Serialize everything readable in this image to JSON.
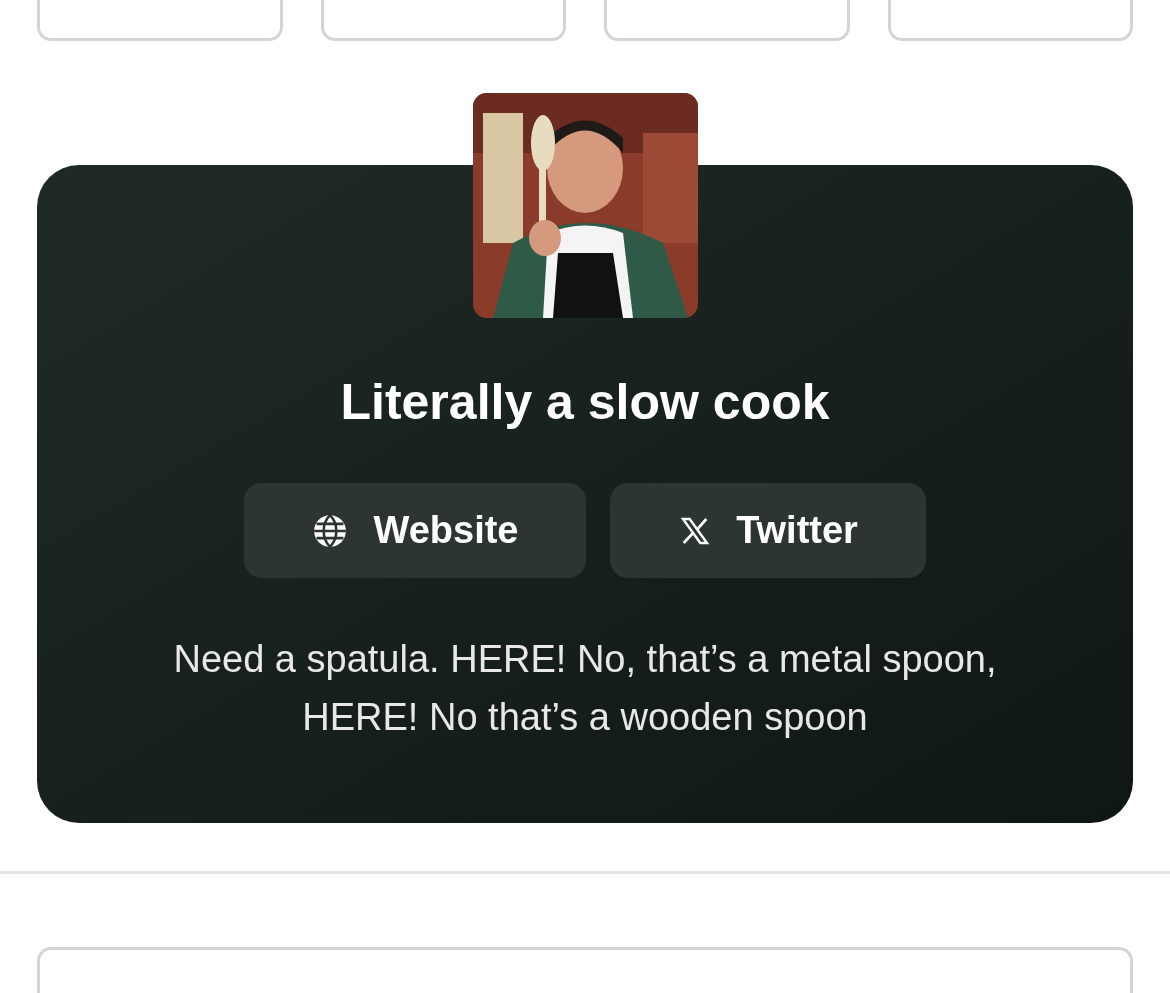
{
  "profile": {
    "title": "Literally a slow cook",
    "links": [
      {
        "kind": "website",
        "label": "Website"
      },
      {
        "kind": "x",
        "label": "Twitter"
      }
    ],
    "bio": "Need a spatula. HERE! No, that’s a metal spoon, HERE! No that’s a wooden spoon"
  }
}
